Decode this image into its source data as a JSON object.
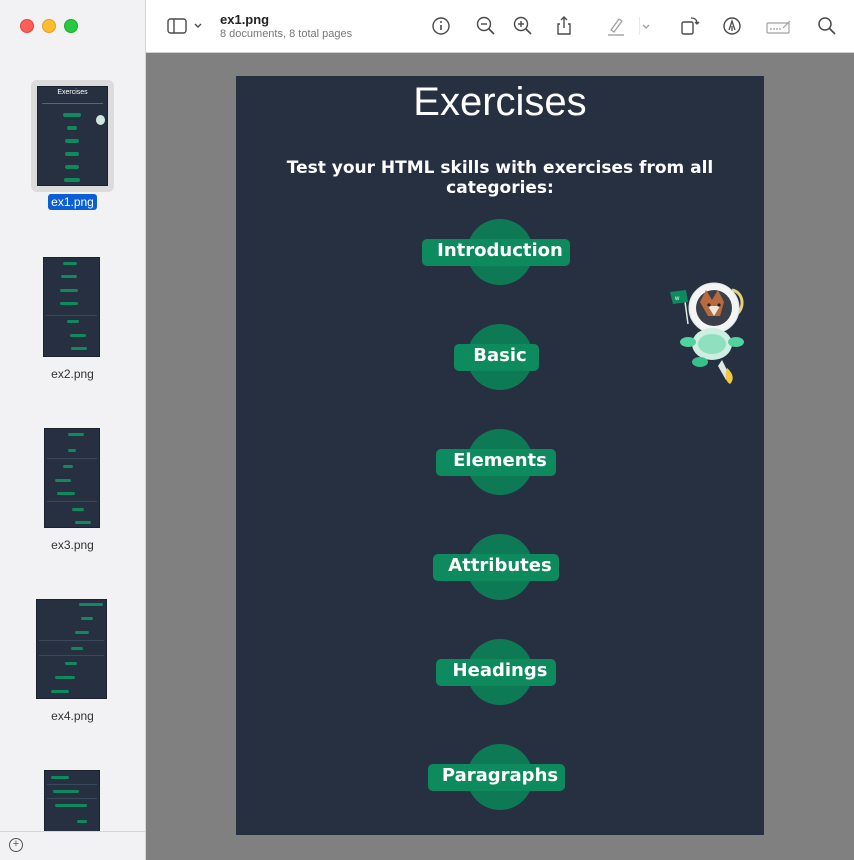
{
  "toolbar": {
    "file_name": "ex1.png",
    "subtitle": "8 documents, 8 total pages",
    "icons": [
      "sidebar-icon",
      "info-icon",
      "zoom-out-icon",
      "zoom-in-icon",
      "share-icon",
      "highlight-icon",
      "rotate-icon",
      "markup-icon",
      "sign-icon",
      "search-icon"
    ]
  },
  "sidebar": {
    "items": [
      {
        "label": "ex1.png",
        "selected": true
      },
      {
        "label": "ex2.png",
        "selected": false
      },
      {
        "label": "ex3.png",
        "selected": false
      },
      {
        "label": "ex4.png",
        "selected": false
      },
      {
        "label": "",
        "selected": false
      }
    ]
  },
  "page": {
    "title": "Exercises",
    "subtitle": "Test your HTML skills with exercises from all categories:",
    "exercises": [
      {
        "label": "Introduction"
      },
      {
        "label": "Basic"
      },
      {
        "label": "Elements"
      },
      {
        "label": "Attributes"
      },
      {
        "label": "Headings"
      },
      {
        "label": "Paragraphs"
      }
    ]
  },
  "colors": {
    "page_bg": "#263040",
    "button_green": "#0e8a5f",
    "circle_green": "#0d7a55",
    "selection_blue": "#0a5fd6"
  }
}
